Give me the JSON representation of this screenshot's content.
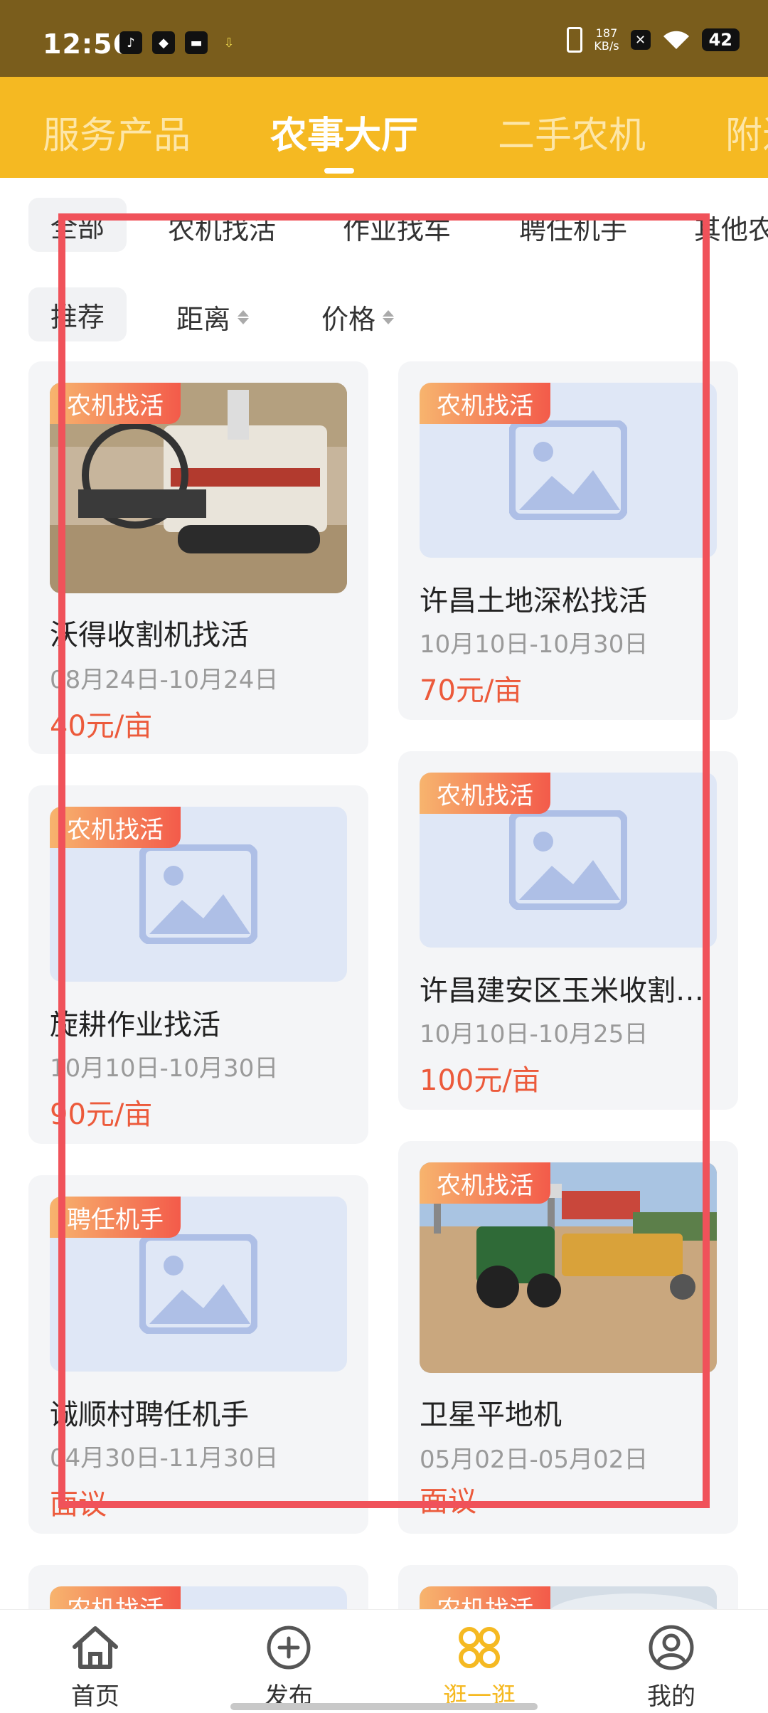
{
  "status_bar": {
    "time": "12:56",
    "net_speed_value": "187",
    "net_speed_unit": "KB/s",
    "battery": "42"
  },
  "top_tabs": [
    {
      "label": "服务产品",
      "active": false
    },
    {
      "label": "农事大厅",
      "active": true
    },
    {
      "label": "二手农机",
      "active": false
    },
    {
      "label": "附近",
      "active": false
    }
  ],
  "categories": [
    "全部",
    "农机找活",
    "作业找车",
    "聘任机手",
    "其他农"
  ],
  "sort": {
    "recommend": "推荐",
    "distance": "距离",
    "price": "价格"
  },
  "cards": [
    {
      "tag": "农机找活",
      "title": "沃得收割机找活",
      "date": "08月24日-10月24日",
      "price": "40元/亩",
      "image": "harvester-photo"
    },
    {
      "tag": "农机找活",
      "title": "许昌土地深松找活",
      "date": "10月10日-10月30日",
      "price": "70元/亩",
      "image": "placeholder"
    },
    {
      "tag": "农机找活",
      "title": "旋耕作业找活",
      "date": "10月10日-10月30日",
      "price": "90元/亩",
      "image": "placeholder"
    },
    {
      "tag": "农机找活",
      "title": "许昌建安区玉米收割…",
      "date": "10月10日-10月25日",
      "price": "100元/亩",
      "image": "placeholder"
    },
    {
      "tag": "聘任机手",
      "title": "诚顺村聘任机手",
      "date": "04月30日-11月30日",
      "price": "面议",
      "image": "placeholder"
    },
    {
      "tag": "农机找活",
      "title": "卫星平地机",
      "date": "05月02日-05月02日",
      "price": "面议",
      "image": "tractor-photo"
    },
    {
      "tag": "农机找活",
      "image": "placeholder"
    },
    {
      "tag": "农机找活",
      "image": "sky-photo"
    }
  ],
  "bottom_nav": [
    {
      "label": "首页",
      "icon": "home-icon",
      "active": false
    },
    {
      "label": "发布",
      "icon": "plus-circle-icon",
      "active": false
    },
    {
      "label": "逛一逛",
      "icon": "browse-icon",
      "active": true
    },
    {
      "label": "我的",
      "icon": "user-icon",
      "active": false
    }
  ],
  "colors": {
    "brand": "#f5b922",
    "status_bar": "#7a5d1c",
    "price": "#ec5a3b",
    "highlight_frame": "#f0525a"
  }
}
